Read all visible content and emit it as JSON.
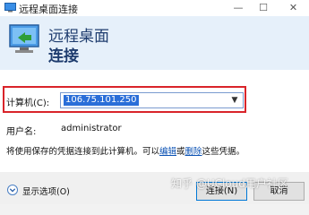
{
  "window": {
    "title": "远程桌面连接",
    "controls": {
      "minimize": "—",
      "maximize": "☐",
      "close": "✕"
    }
  },
  "header": {
    "line1": "远程桌面",
    "line2": "连接"
  },
  "form": {
    "computer_label": "计算机(C):",
    "computer_value": "106.75.101.250",
    "username_label": "用户名:",
    "username_value": "administrator",
    "note_prefix": "将使用保存的凭据连接到此计算机。可以",
    "note_edit_link": "编辑",
    "note_mid": "或",
    "note_delete_link": "删除",
    "note_suffix": "这些凭据。"
  },
  "footer": {
    "show_options": "显示选项(O)",
    "connect": "连接(N)",
    "cancel": "取消"
  },
  "watermark": "知乎 @UCloud用户社区",
  "colors": {
    "header_bg": "#e6f0fa",
    "highlight_border": "#d9242a",
    "selection": "#2a6ed8",
    "link": "#0b52b4"
  }
}
